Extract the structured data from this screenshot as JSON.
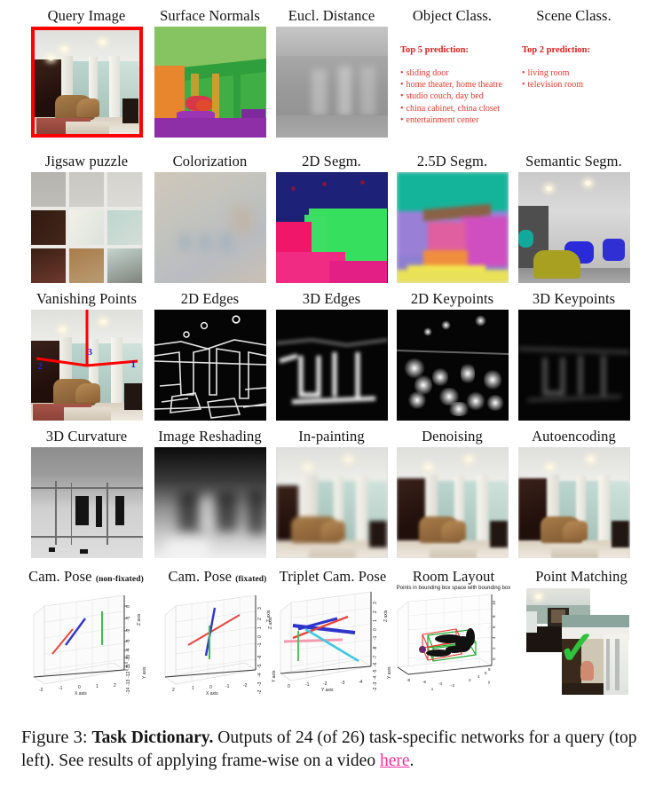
{
  "figure": {
    "caption_prefix": "Figure 3:",
    "caption_bold": "Task Dictionary.",
    "caption_text_1": " Outputs of 24 (of 26) task-specific networks for a query (top left). See results of applying frame-wise on a video ",
    "caption_link": "here",
    "caption_text_2": "."
  },
  "colors": {
    "query_border": "#ff0000",
    "prediction_title": "#e01b1b",
    "prediction_item": "#e23a2e",
    "link": "#ff2e9a",
    "vanishing_axis": "#ff0000",
    "vanishing_label": "#2222dd",
    "check_mark": "#2fc23d",
    "layout_box_green": "#1faa32",
    "layout_box_red": "#ee3b33"
  },
  "rows": [
    {
      "cells": [
        {
          "label": "Query Image",
          "type": "image",
          "name": "query-image"
        },
        {
          "label": "Surface Normals",
          "type": "image",
          "name": "surface-normals"
        },
        {
          "label": "Eucl. Distance",
          "type": "image",
          "name": "euclidean-distance"
        },
        {
          "label": "Object Class.",
          "type": "prediction",
          "name": "object-classification"
        },
        {
          "label": "Scene Class.",
          "type": "prediction",
          "name": "scene-classification"
        }
      ]
    },
    {
      "cells": [
        {
          "label": "Jigsaw puzzle",
          "type": "image",
          "name": "jigsaw-puzzle"
        },
        {
          "label": "Colorization",
          "type": "image",
          "name": "colorization"
        },
        {
          "label": "2D Segm.",
          "type": "image",
          "name": "2d-segmentation"
        },
        {
          "label": "2.5D Segm.",
          "type": "image",
          "name": "25d-segmentation"
        },
        {
          "label": "Semantic Segm.",
          "type": "image",
          "name": "semantic-segmentation"
        }
      ]
    },
    {
      "cells": [
        {
          "label": "Vanishing Points",
          "type": "image",
          "name": "vanishing-points"
        },
        {
          "label": "2D Edges",
          "type": "image",
          "name": "2d-edges"
        },
        {
          "label": "3D Edges",
          "type": "image",
          "name": "3d-edges"
        },
        {
          "label": "2D Keypoints",
          "type": "image",
          "name": "2d-keypoints"
        },
        {
          "label": "3D Keypoints",
          "type": "image",
          "name": "3d-keypoints"
        }
      ]
    },
    {
      "cells": [
        {
          "label": "3D Curvature",
          "type": "image",
          "name": "3d-curvature"
        },
        {
          "label": "Image Reshading",
          "type": "image",
          "name": "image-reshading"
        },
        {
          "label": "In-painting",
          "type": "image",
          "name": "in-painting"
        },
        {
          "label": "Denoising",
          "type": "image",
          "name": "denoising"
        },
        {
          "label": "Autoencoding",
          "type": "image",
          "name": "autoencoding"
        }
      ]
    },
    {
      "cells": [
        {
          "label": "Cam. Pose ",
          "sub": "(non-fixated)",
          "type": "plot",
          "name": "cam-pose-non-fixated"
        },
        {
          "label": "Cam. Pose ",
          "sub": "(fixated)",
          "type": "plot",
          "name": "cam-pose-fixated"
        },
        {
          "label": "Triplet Cam. Pose",
          "type": "plot",
          "name": "triplet-cam-pose"
        },
        {
          "label": "Room Layout",
          "type": "plot",
          "name": "room-layout"
        },
        {
          "label": "Point Matching",
          "type": "image",
          "name": "point-matching"
        }
      ]
    }
  ],
  "object_class": {
    "title": "Top 5 prediction:",
    "items": [
      "sliding door",
      "home theater, home theatre",
      "studio couch, day bed",
      "china cabinet, china closet",
      "entertainment center"
    ]
  },
  "scene_class": {
    "title": "Top 2 prediction:",
    "items": [
      "living room",
      "television room"
    ]
  },
  "vanishing_points": {
    "labels": [
      "1",
      "2",
      "3"
    ]
  },
  "chart_data": [
    {
      "type": "scatter",
      "name": "cam-pose-non-fixated",
      "title": "",
      "xlabel": "X axis",
      "ylabel": "Y axis",
      "zlabel": "Z axis",
      "xticks": [
        "-2",
        "-1",
        "0",
        "1",
        "2"
      ],
      "zticks": [
        "0",
        "-1",
        "-2",
        "-3",
        "-4"
      ],
      "yticks": [
        "-10",
        "-11",
        "-12",
        "-13",
        "-14"
      ],
      "grid": true,
      "series": [
        {
          "name": "red-camera",
          "color": "#e8453c"
        },
        {
          "name": "blue-camera",
          "color": "#2f35c9"
        },
        {
          "name": "green-axis",
          "color": "#3fbf4f"
        }
      ]
    },
    {
      "type": "scatter",
      "name": "cam-pose-fixated",
      "title": "",
      "xlabel": "X axis",
      "ylabel": "Y axis",
      "zlabel": "Z axis",
      "xticks": [
        "2",
        "1",
        "0",
        "-1",
        "-2"
      ],
      "zticks": [
        "3",
        "2",
        "1",
        "0",
        "-1"
      ],
      "yticks": [
        "-6",
        "-5",
        "-4",
        "-3",
        "-2"
      ],
      "grid": true,
      "series": [
        {
          "name": "red-camera",
          "color": "#e8453c"
        },
        {
          "name": "blue-camera",
          "color": "#2f35c9"
        },
        {
          "name": "green-axis",
          "color": "#3fbf4f"
        }
      ]
    },
    {
      "type": "scatter",
      "name": "triplet-cam-pose",
      "title": "",
      "xlabel": "Y axis",
      "ylabel": "Y axis",
      "zlabel": "Z axis",
      "xticks": [
        "0",
        "-1",
        "-2",
        "-3",
        "-4"
      ],
      "zticks": [
        "3",
        "2",
        "1",
        "0",
        "-1"
      ],
      "yticks": [
        "-8",
        "-7",
        "-6",
        "-5",
        "-4",
        "-3",
        "-2"
      ],
      "grid": true,
      "series": [
        {
          "name": "blue-camera",
          "color": "#2f35c9"
        },
        {
          "name": "red-camera",
          "color": "#e8453c"
        },
        {
          "name": "cyan-camera",
          "color": "#3ec9e0"
        },
        {
          "name": "pink-camera",
          "color": "#f49ab0"
        },
        {
          "name": "green-axis",
          "color": "#3fbf4f"
        }
      ]
    },
    {
      "type": "scatter",
      "name": "room-layout",
      "title": "Points in bounding box space with bounding box",
      "xlabel": "x",
      "ylabel": "y",
      "zlabel": "",
      "xticks": [
        "-8",
        "-6",
        "-4",
        "-2"
      ],
      "yticks": [
        "2",
        "4",
        "6",
        "8"
      ],
      "zticks": [
        "0",
        "2",
        "4",
        "6",
        "8",
        "10"
      ],
      "grid": true,
      "series": [
        {
          "name": "point-cloud",
          "color": "#111111"
        },
        {
          "name": "predicted-box",
          "color": "#ee3b33"
        },
        {
          "name": "ground-truth-box",
          "color": "#1faa32"
        }
      ]
    }
  ]
}
